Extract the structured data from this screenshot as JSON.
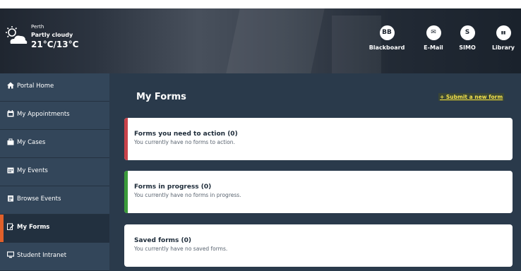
{
  "weather": {
    "city": "Perth",
    "condition": "Partly cloudy",
    "temperature": "21°C/13°C",
    "icon": "partly-cloudy-icon"
  },
  "quick_links": [
    {
      "label": "Blackboard",
      "glyph": "BB",
      "icon": "blackboard-icon"
    },
    {
      "label": "E-Mail",
      "glyph": "✉",
      "icon": "email-icon"
    },
    {
      "label": "SIMO",
      "glyph": "S",
      "icon": "simo-icon"
    },
    {
      "label": "Library",
      "glyph": "▮▮",
      "icon": "library-book-icon"
    }
  ],
  "sidebar": {
    "items": [
      {
        "label": "Portal Home",
        "icon": "home-icon"
      },
      {
        "label": "My Appointments",
        "icon": "calendar-icon"
      },
      {
        "label": "My Cases",
        "icon": "briefcase-icon"
      },
      {
        "label": "My Events",
        "icon": "events-calendar-icon"
      },
      {
        "label": "Browse Events",
        "icon": "browse-events-icon"
      },
      {
        "label": "My Forms",
        "icon": "form-edit-icon",
        "active": true
      },
      {
        "label": "Student Intranet",
        "icon": "monitor-icon"
      }
    ]
  },
  "main": {
    "title": "My Forms",
    "submit_link": "+ Submit a new form",
    "cards": [
      {
        "title": "Forms you need to action (0)",
        "subtitle": "You currently have no forms to action.",
        "accent": "#c9424a"
      },
      {
        "title": "Forms in progress (0)",
        "subtitle": "You currently have no forms in progress.",
        "accent": "#3a9a3a"
      },
      {
        "title": "Saved forms (0)",
        "subtitle": "You currently have no saved forms.",
        "accent": "#ffffff"
      }
    ]
  },
  "colors": {
    "accent_active": "#e0602a",
    "submit_link": "#f4e24a",
    "page_background": "#2a3a4b"
  }
}
